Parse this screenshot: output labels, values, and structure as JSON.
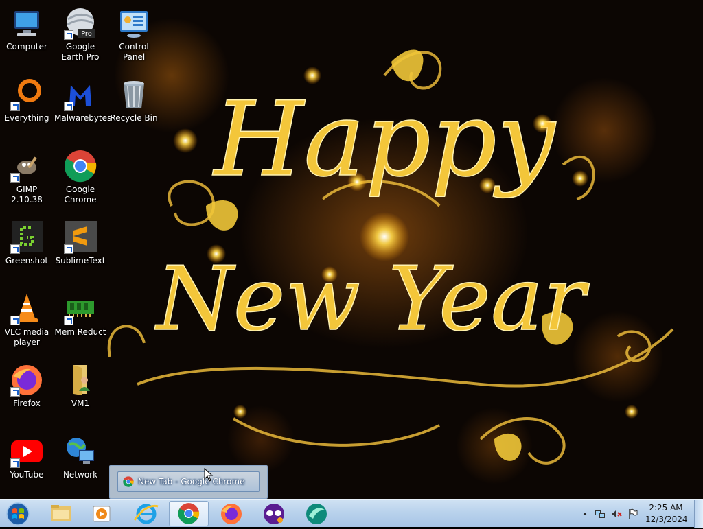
{
  "desktop": {
    "wallpaper": {
      "line1": "Happy",
      "line2": "New Year",
      "colors": {
        "gold": "#f3c63a",
        "glow": "#ffcc33",
        "background": "#0c0603"
      }
    },
    "icons": [
      {
        "label": "Computer",
        "icon": "computer-icon",
        "shortcut": false
      },
      {
        "label": "Google Earth Pro",
        "icon": "google-earth-pro-icon",
        "shortcut": true
      },
      {
        "label": "Control Panel",
        "icon": "control-panel-icon",
        "shortcut": false
      },
      {
        "label": "Everything",
        "icon": "everything-icon",
        "shortcut": true
      },
      {
        "label": "Malwarebytes",
        "icon": "malwarebytes-icon",
        "shortcut": true
      },
      {
        "label": "Recycle Bin",
        "icon": "recycle-bin-icon",
        "shortcut": false
      },
      {
        "label": "GIMP 2.10.38",
        "icon": "gimp-icon",
        "shortcut": true
      },
      {
        "label": "Google Chrome",
        "icon": "chrome-icon",
        "shortcut": false
      },
      {
        "label": "Greenshot",
        "icon": "greenshot-icon",
        "shortcut": true
      },
      {
        "label": "SublimeText",
        "icon": "sublime-text-icon",
        "shortcut": true
      },
      {
        "label": "VLC media player",
        "icon": "vlc-icon",
        "shortcut": true
      },
      {
        "label": "Mem Reduct",
        "icon": "mem-reduct-icon",
        "shortcut": true
      },
      {
        "label": "Firefox",
        "icon": "firefox-icon",
        "shortcut": true
      },
      {
        "label": "VM1",
        "icon": "folder-user-icon",
        "shortcut": false
      },
      {
        "label": "YouTube",
        "icon": "youtube-icon",
        "shortcut": true
      },
      {
        "label": "Network",
        "icon": "network-icon",
        "shortcut": false
      }
    ],
    "pro_badge": "Pro"
  },
  "thumbnail": {
    "title": "New Tab - Google Chrome",
    "icon": "chrome-icon"
  },
  "taskbar": {
    "start_icon": "windows-start-orb-icon",
    "pinned": [
      {
        "name": "windows-explorer",
        "icon": "folder-icon",
        "active": false
      },
      {
        "name": "media-player",
        "icon": "media-player-icon",
        "active": false
      },
      {
        "name": "internet-explorer",
        "icon": "internet-explorer-icon",
        "active": false
      },
      {
        "name": "google-chrome",
        "icon": "chrome-icon",
        "active": true
      },
      {
        "name": "firefox",
        "icon": "firefox-icon",
        "active": false
      },
      {
        "name": "vpn-mask-app",
        "icon": "mask-icon",
        "active": false
      },
      {
        "name": "round-app",
        "icon": "round-app-icon",
        "active": false
      }
    ],
    "tray": {
      "icons": [
        "chevron-up-icon",
        "network-icon",
        "volume-muted-icon",
        "action-center-flag-icon"
      ],
      "time": "2:25 AM",
      "date": "12/3/2024"
    },
    "colors": {
      "bar": "#b9d2ec"
    }
  }
}
